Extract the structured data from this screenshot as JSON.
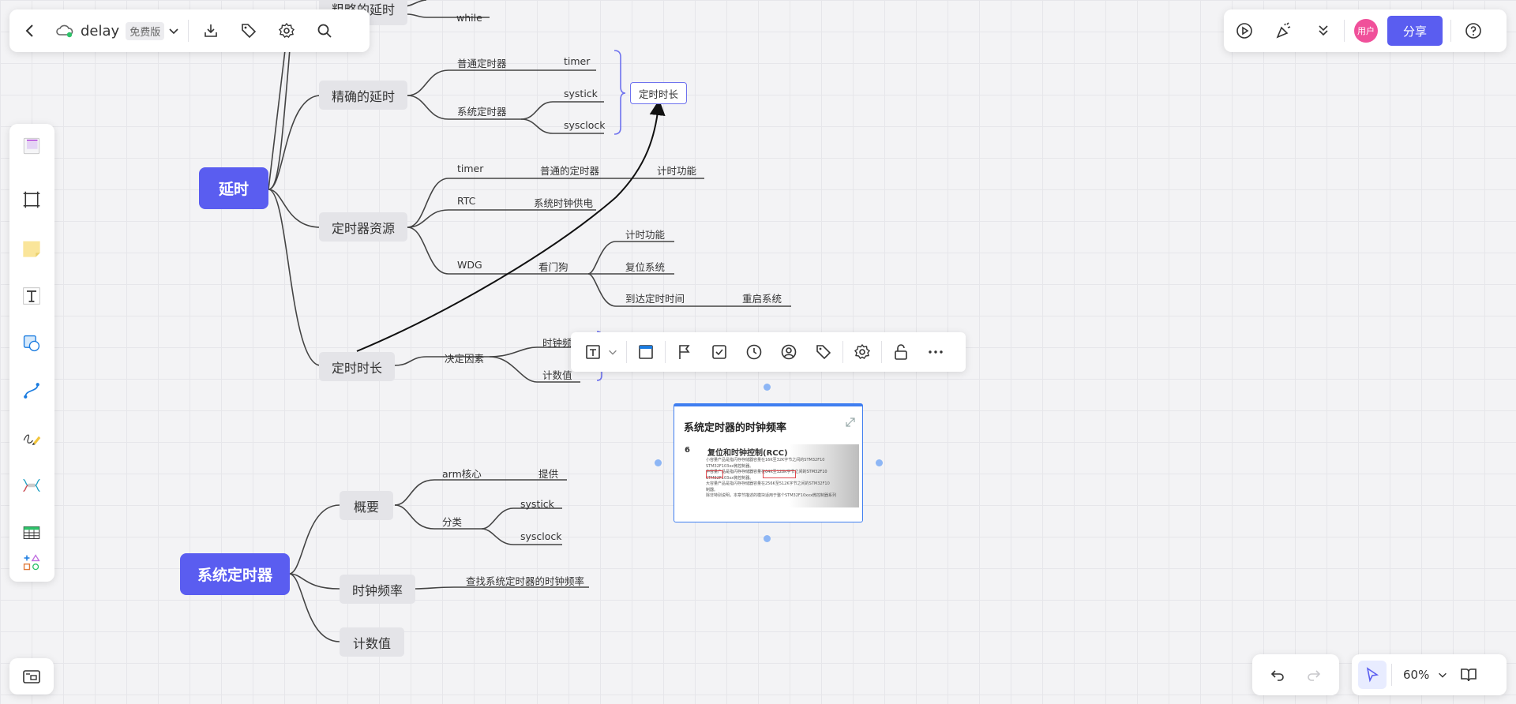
{
  "topbar": {
    "doc_title": "delay",
    "plan_badge": "免费版"
  },
  "right_bar": {
    "avatar": "用户",
    "share_label": "分享"
  },
  "zoom": {
    "level": "60%"
  },
  "mindmap_delay": {
    "root": "延时",
    "partial_branch": "粗略的延时",
    "partial_leaf": "while",
    "precise": {
      "label": "精确的延时",
      "general_timer": "普通定时器",
      "timer": "timer",
      "systick_timer": "系统定时器",
      "systick": "systick",
      "sysclock": "sysclock",
      "summary": "定时时长"
    },
    "resources": {
      "label": "定时器资源",
      "timer": "timer",
      "timer_desc": "普通的定时器",
      "timer_func": "计时功能",
      "rtc": "RTC",
      "rtc_desc": "系统时钟供电",
      "wdg": "WDG",
      "wdg_desc": "看门狗",
      "wdg_func1": "计时功能",
      "wdg_func2": "复位系统",
      "wdg_func3": "到达定时时间",
      "wdg_func3_result": "重启系统"
    },
    "duration": {
      "label": "定时时长",
      "factor": "决定因素",
      "freq": "时钟频",
      "count": "计数值"
    }
  },
  "mindmap_systick": {
    "root": "系统定时器",
    "overview": {
      "label": "概要",
      "arm_core": "arm核心",
      "provide": "提供",
      "category": "分类",
      "systick": "systick",
      "sysclock": "sysclock"
    },
    "clock_freq": {
      "label": "时钟频率",
      "desc": "查找系统定时器的时钟频率"
    },
    "count": {
      "label": "计数值"
    }
  },
  "image_card": {
    "title": "系统定时器的时钟频率",
    "doc_chapter": "6",
    "doc_heading": "复位和时钟控制(RCC)",
    "doc_lines": [
      "小容量产品是指闪存存储器容量在16K至32K字节之间的STM32F10",
      "STM32F103xx微控制器。",
      "中容量产品是指闪存存储器容量在64K至128K字节之间的STM32F10",
      "STM32F103xx微控制器。",
      "大容量产品是指闪存存储器容量在256K至512K字节之间的STM32F10",
      "制器。",
      "除非特别说明，本章节描述的模块适用于整个STM32F10xxx微控制器系列"
    ]
  },
  "colors": {
    "accent": "#5a5df0",
    "node_bg": "#e4e4e8",
    "selection": "#3f7ef0"
  }
}
